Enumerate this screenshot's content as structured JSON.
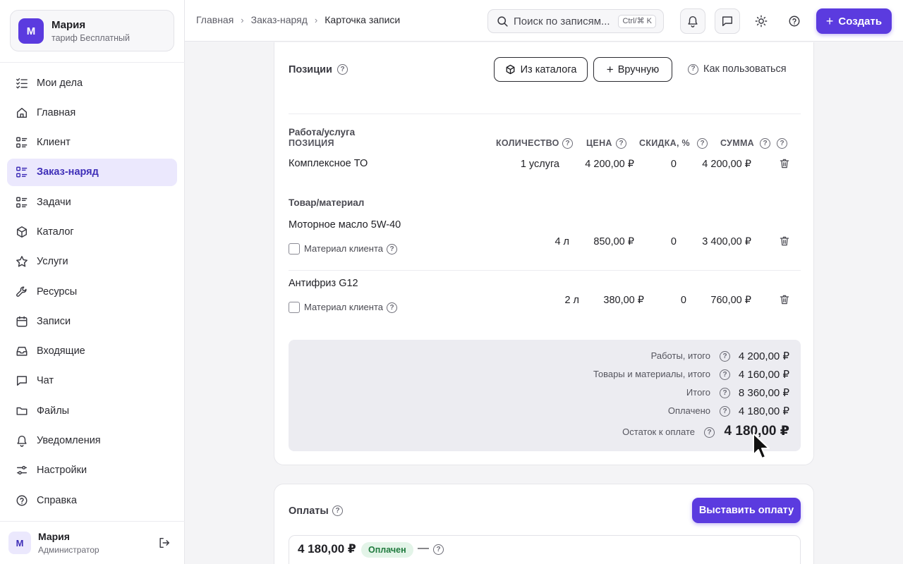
{
  "account": {
    "initial": "М",
    "name": "Мария",
    "plan": "тариф Бесплатный"
  },
  "nav": [
    {
      "label": "Мои дела",
      "icon": "todo-list-icon"
    },
    {
      "label": "Главная",
      "icon": "home-icon"
    },
    {
      "label": "Клиент",
      "icon": "list-icon"
    },
    {
      "label": "Заказ-наряд",
      "icon": "list-icon",
      "active": true
    },
    {
      "label": "Задачи",
      "icon": "list-icon"
    },
    {
      "label": "Каталог",
      "icon": "box-icon"
    },
    {
      "label": "Услуги",
      "icon": "star-icon"
    },
    {
      "label": "Ресурсы",
      "icon": "wrench-icon"
    },
    {
      "label": "Записи",
      "icon": "calendar-icon"
    },
    {
      "label": "Входящие",
      "icon": "inbox-icon"
    },
    {
      "label": "Чат",
      "icon": "chat-icon"
    },
    {
      "label": "Файлы",
      "icon": "folder-icon"
    },
    {
      "label": "Уведомления",
      "icon": "bell-icon"
    },
    {
      "label": "Настройки",
      "icon": "sliders-icon"
    },
    {
      "label": "Справка",
      "icon": "help-icon"
    }
  ],
  "user": {
    "initial": "М",
    "name": "Мария",
    "role": "Администратор"
  },
  "breadcrumbs": [
    "Главная",
    "Заказ-наряд",
    "Карточка записи"
  ],
  "search": {
    "placeholder": "Поиск по записям...",
    "shortcut": "Ctrl/⌘ K"
  },
  "create_label": "Создать",
  "positions": {
    "title": "Позиции",
    "from_catalog": "Из каталога",
    "manual": "Вручную",
    "how_to": "Как пользоваться",
    "columns": {
      "position": "ПОЗИЦИЯ",
      "quantity": "КОЛИЧЕСТВО",
      "price": "ЦЕНА",
      "discount": "СКИДКА, %",
      "sum": "СУММА"
    },
    "group_work": "Работа/услуга",
    "group_goods": "Товар/материал",
    "client_material": "Материал клиента",
    "rows": [
      {
        "name": "Комплексное ТО",
        "qty": "1 услуга",
        "price": "4 200,00 ₽",
        "discount": "0",
        "sum": "4 200,00 ₽"
      },
      {
        "name": "Моторное масло 5W-40",
        "qty": "4 л",
        "price": "850,00 ₽",
        "discount": "0",
        "sum": "3 400,00 ₽"
      },
      {
        "name": "Антифриз G12",
        "qty": "2 л",
        "price": "380,00 ₽",
        "discount": "0",
        "sum": "760,00 ₽"
      }
    ],
    "totals": [
      {
        "label": "Работы, итого",
        "value": "4 200,00 ₽"
      },
      {
        "label": "Товары и материалы, итого",
        "value": "4 160,00 ₽"
      },
      {
        "label": "Итого",
        "value": "8 360,00 ₽"
      },
      {
        "label": "Оплачено",
        "value": "4 180,00 ₽"
      },
      {
        "label": "Остаток к оплате",
        "value": "4 180,00 ₽"
      }
    ]
  },
  "payments": {
    "title": "Оплаты",
    "issue_button": "Выставить оплату",
    "item": {
      "amount": "4 180,00 ₽",
      "status": "Оплачен",
      "dash": "—"
    }
  },
  "colors": {
    "accent": "#5b3bdf",
    "active_bg": "#ebe8fd",
    "paid_badge": "#e3f4e8"
  }
}
